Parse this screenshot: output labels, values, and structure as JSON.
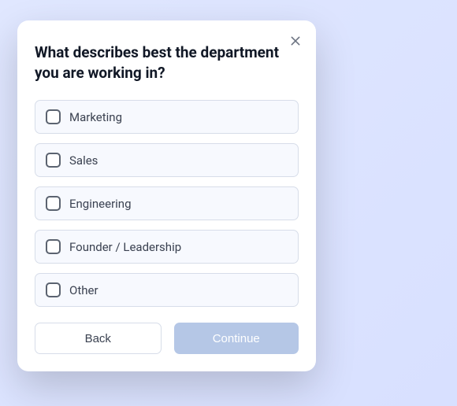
{
  "modal": {
    "title": "What describes best the department you are working in?",
    "options": [
      {
        "label": "Marketing"
      },
      {
        "label": "Sales"
      },
      {
        "label": "Engineering"
      },
      {
        "label": "Founder / Leadership"
      },
      {
        "label": "Other"
      }
    ],
    "back_label": "Back",
    "continue_label": "Continue"
  }
}
